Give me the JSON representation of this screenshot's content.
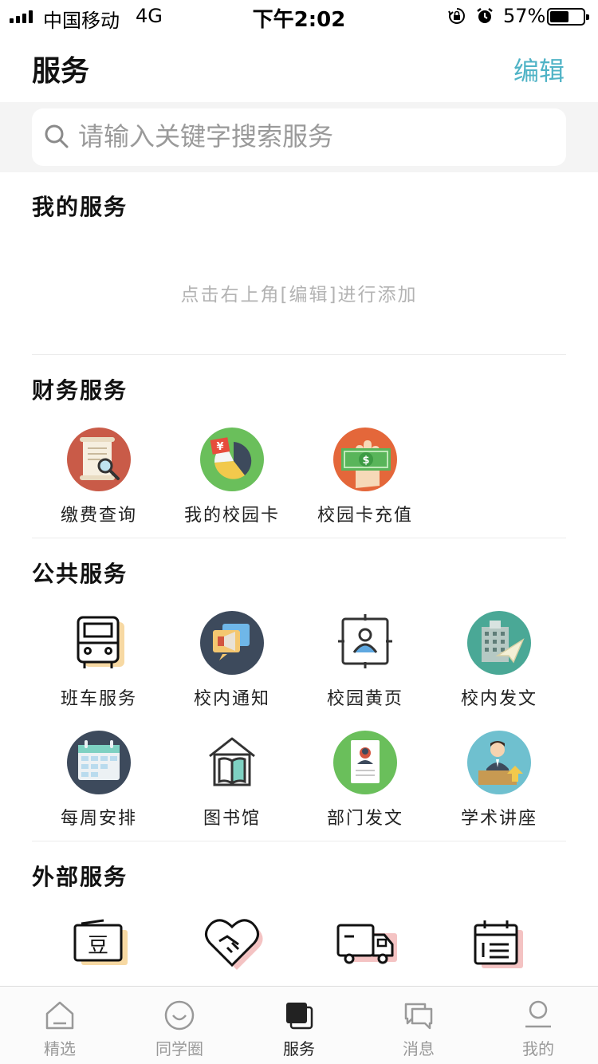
{
  "status_bar": {
    "carrier": "中国移动",
    "network": "4G",
    "time": "下午2:02",
    "battery_percent": "57%",
    "battery_level": 0.57
  },
  "header": {
    "title": "服务",
    "edit_label": "编辑"
  },
  "search": {
    "placeholder": "请输入关键字搜索服务"
  },
  "my_services": {
    "title": "我的服务",
    "empty_hint": "点击右上角[编辑]进行添加"
  },
  "finance": {
    "title": "财务服务",
    "items": [
      {
        "label": "缴费查询",
        "icon": "receipt-search-icon"
      },
      {
        "label": "我的校园卡",
        "icon": "pie-chart-yuan-icon"
      },
      {
        "label": "校园卡充值",
        "icon": "hand-money-icon"
      }
    ]
  },
  "public": {
    "title": "公共服务",
    "items": [
      {
        "label": "班车服务",
        "icon": "bus-icon"
      },
      {
        "label": "校内通知",
        "icon": "megaphone-icon"
      },
      {
        "label": "校园黄页",
        "icon": "contact-card-icon"
      },
      {
        "label": "校内发文",
        "icon": "building-plane-icon"
      },
      {
        "label": "每周安排",
        "icon": "calendar-icon"
      },
      {
        "label": "图书馆",
        "icon": "library-book-icon"
      },
      {
        "label": "部门发文",
        "icon": "document-badge-icon"
      },
      {
        "label": "学术讲座",
        "icon": "lecturer-icon"
      }
    ]
  },
  "external": {
    "title": "外部服务",
    "items": [
      {
        "label": "豆",
        "icon": "douban-tv-icon"
      },
      {
        "icon": "heart-handshake-icon"
      },
      {
        "icon": "delivery-truck-icon"
      },
      {
        "icon": "calendar-note-icon"
      }
    ]
  },
  "tabs": [
    {
      "label": "精选",
      "icon": "home-icon"
    },
    {
      "label": "同学圈",
      "icon": "smile-circle-icon"
    },
    {
      "label": "服务",
      "icon": "service-squares-icon",
      "active": true
    },
    {
      "label": "消息",
      "icon": "chat-bubbles-icon"
    },
    {
      "label": "我的",
      "icon": "user-icon"
    }
  ],
  "colors": {
    "accent": "#4fb3c6",
    "search_bg": "#f4f4f4",
    "hint": "#b3b3b3"
  }
}
